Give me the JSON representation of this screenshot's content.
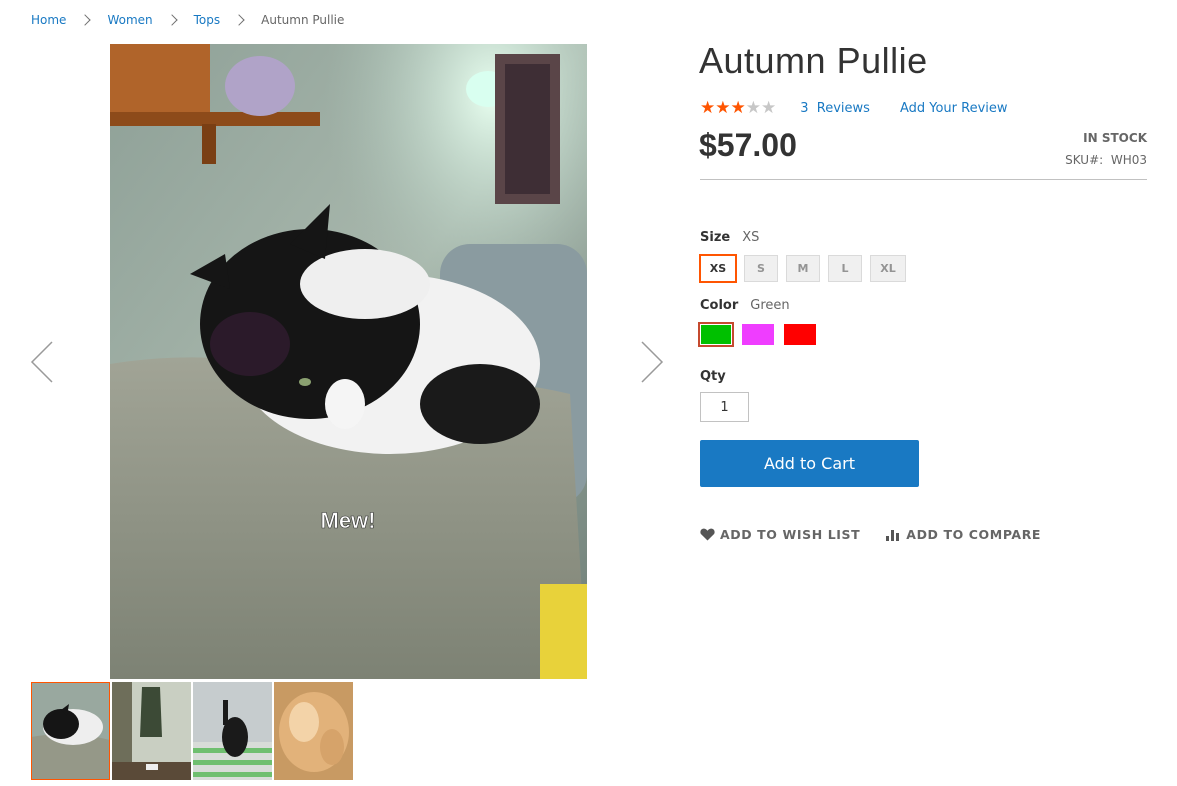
{
  "breadcrumbs": [
    {
      "label": "Home"
    },
    {
      "label": "Women"
    },
    {
      "label": "Tops"
    },
    {
      "label": "Autumn Pullie"
    }
  ],
  "product": {
    "title": "Autumn Pullie",
    "rating": {
      "stars_filled": 3,
      "stars_total": 5
    },
    "reviews_count": "3",
    "reviews_word": "Reviews",
    "add_review_label": "Add Your Review",
    "price": "$57.00",
    "stock_status": "IN STOCK",
    "sku_label": "SKU#:",
    "sku_value": "WH03"
  },
  "gallery": {
    "main_image_caption": "Mew!",
    "thumbnail_count": 4,
    "active_thumbnail": 1,
    "prev_icon": "chevron-left-icon",
    "next_icon": "chevron-right-icon"
  },
  "options": {
    "size_label": "Size",
    "size_selected": "XS",
    "sizes": [
      "XS",
      "S",
      "M",
      "L",
      "XL"
    ],
    "color_label": "Color",
    "color_selected": "Green",
    "colors": [
      {
        "name": "Green",
        "hex": "#00c000"
      },
      {
        "name": "Purple",
        "hex": "#ef3dff"
      },
      {
        "name": "Red",
        "hex": "#ff0000"
      }
    ]
  },
  "qty": {
    "label": "Qty",
    "value": "1"
  },
  "cart": {
    "add_label": "Add to Cart"
  },
  "actions": {
    "wishlist_label": "ADD TO WISH LIST",
    "wishlist_icon": "heart-icon",
    "compare_label": "ADD TO COMPARE",
    "compare_icon": "bar-chart-icon"
  },
  "theme": {
    "link": "#1979c3",
    "accent": "#ff5501",
    "button_bg": "#1979c3"
  }
}
